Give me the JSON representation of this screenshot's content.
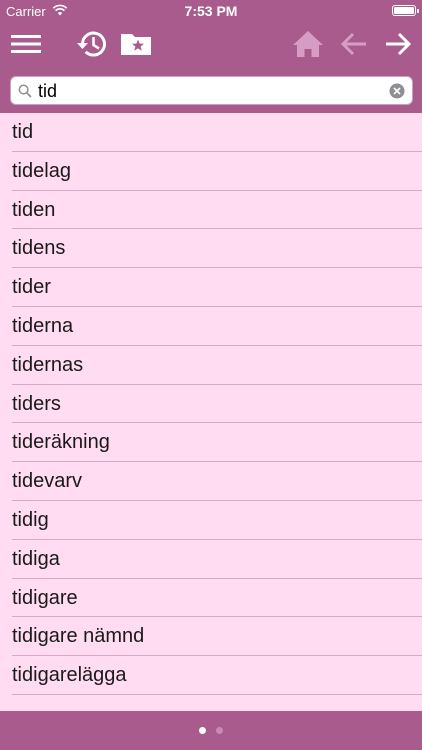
{
  "status_bar": {
    "carrier": "Carrier",
    "time": "7:53 PM"
  },
  "toolbar": {
    "icons": [
      "menu-icon",
      "history-icon",
      "favorites-folder-icon",
      "home-icon",
      "back-arrow-icon",
      "forward-arrow-icon"
    ],
    "colors": {
      "bar": "#a95b8e",
      "active_icon": "#ffffff",
      "disabled_icon": "#d79cc4"
    }
  },
  "search": {
    "value": "tid",
    "placeholder": ""
  },
  "results": [
    "tid",
    "tidelag",
    "tiden",
    "tidens",
    "tider",
    "tiderna",
    "tidernas",
    "tiders",
    "tideräkning",
    "tidevarv",
    "tidig",
    "tidiga",
    "tidigare",
    "tidigare nämnd",
    "tidigarelägga"
  ],
  "pager": {
    "pages": 2,
    "current": 1
  },
  "colors": {
    "list_background": "#ffdcf2",
    "separator": "#d8a9c7"
  }
}
